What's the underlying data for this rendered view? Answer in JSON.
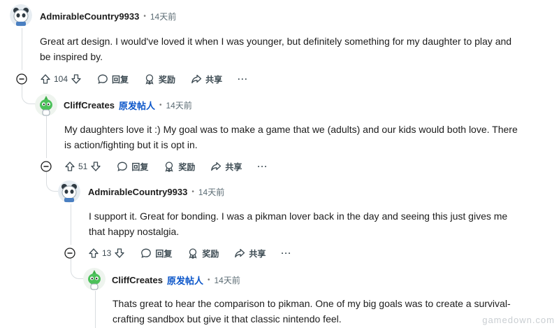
{
  "comments": [
    {
      "author": "AdmirableCountry9933",
      "op_badge": "",
      "time": "14天前",
      "avatar": "panda-avatar",
      "text_lines": [
        "Great art design. I would've loved it when I was younger, but definitely something for my daughter to play and",
        "be inspired by."
      ],
      "votes": "104",
      "reply_label": "回复",
      "award_label": "奖励",
      "share_label": "共享",
      "more_label": "···"
    },
    {
      "author": "CliffCreates",
      "op_badge": "原发帖人",
      "time": "14天前",
      "avatar": "green-creature-avatar",
      "text_lines": [
        "My daughters love it :) My goal was to make a game that we (adults) and our kids would both love. There",
        "is action/fighting but it is opt in."
      ],
      "votes": "51",
      "reply_label": "回复",
      "award_label": "奖励",
      "share_label": "共享",
      "more_label": "···"
    },
    {
      "author": "AdmirableCountry9933",
      "op_badge": "",
      "time": "14天前",
      "avatar": "panda-avatar",
      "text_lines": [
        "I support it. Great for bonding. I was a pikman lover back in the day and seeing this just gives me",
        "that happy nostalgia."
      ],
      "votes": "13",
      "reply_label": "回复",
      "award_label": "奖励",
      "share_label": "共享",
      "more_label": "···"
    },
    {
      "author": "CliffCreates",
      "op_badge": "原发帖人",
      "time": "14天前",
      "avatar": "green-creature-avatar",
      "text_lines": [
        "Thats great to hear the comparison to pikman. One of my big goals was to create a survival-",
        "crafting sandbox but give it that classic nintendo feel."
      ]
    }
  ],
  "separator": "•",
  "watermark": "gamedown.com",
  "colors": {
    "op_badge": "#0a55c9",
    "thread_line": "#d9dde0",
    "meta": "#5c6c74"
  }
}
